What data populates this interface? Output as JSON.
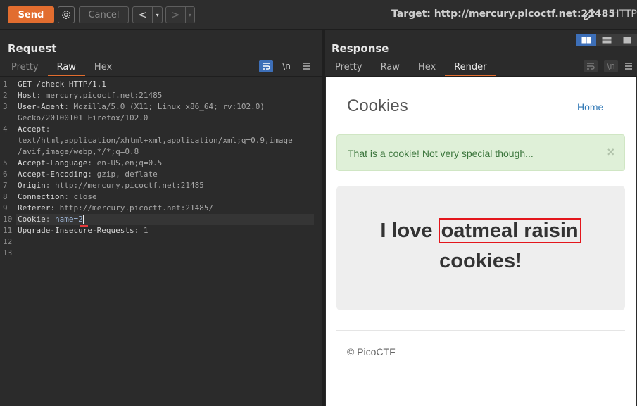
{
  "toolbar": {
    "send_label": "Send",
    "cancel_label": "Cancel",
    "back_glyph": "<",
    "forward_glyph": ">",
    "dropdown_glyph": "▾",
    "target_text": "Target: http://mercury.picoctf.net:21485",
    "http_label": "HTTP/"
  },
  "request": {
    "title": "Request",
    "tabs": [
      "Pretty",
      "Raw",
      "Hex"
    ],
    "active_tab": "Raw",
    "lines": [
      {
        "num": "1",
        "key": "GET /check HTTP/1.1",
        "sep": "",
        "val": ""
      },
      {
        "num": "2",
        "key": "Host",
        "sep": ": ",
        "val": "mercury.picoctf.net:21485"
      },
      {
        "num": "3",
        "key": "User-Agent",
        "sep": ": ",
        "val": "Mozilla/5.0 (X11; Linux x86_64; rv:102.0)"
      },
      {
        "num": "",
        "key": "",
        "sep": "",
        "val": "Gecko/20100101 Firefox/102.0"
      },
      {
        "num": "4",
        "key": "Accept",
        "sep": ":",
        "val": ""
      },
      {
        "num": "",
        "key": "",
        "sep": "",
        "val": "text/html,application/xhtml+xml,application/xml;q=0.9,image"
      },
      {
        "num": "",
        "key": "",
        "sep": "",
        "val": "/avif,image/webp,*/*;q=0.8"
      },
      {
        "num": "5",
        "key": "Accept-Language",
        "sep": ": ",
        "val": "en-US,en;q=0.5"
      },
      {
        "num": "6",
        "key": "Accept-Encoding",
        "sep": ": ",
        "val": "gzip, deflate"
      },
      {
        "num": "7",
        "key": "Origin",
        "sep": ": ",
        "val": "http://mercury.picoctf.net:21485"
      },
      {
        "num": "8",
        "key": "Connection",
        "sep": ": ",
        "val": "close"
      },
      {
        "num": "9",
        "key": "Referer",
        "sep": ": ",
        "val": "http://mercury.picoctf.net:21485/"
      },
      {
        "num": "10",
        "key": "Cookie",
        "sep": ": ",
        "val": "name=2"
      },
      {
        "num": "11",
        "key": "Upgrade-Insecure-Requests",
        "sep": ": ",
        "val": "1"
      },
      {
        "num": "12",
        "key": "",
        "sep": "",
        "val": ""
      },
      {
        "num": "13",
        "key": "",
        "sep": "",
        "val": ""
      }
    ],
    "tool_icons": [
      "wrap-icon",
      "newline-icon",
      "menu-icon"
    ],
    "newline_glyph": "\\n"
  },
  "response": {
    "title": "Response",
    "tabs": [
      "Pretty",
      "Raw",
      "Hex",
      "Render"
    ],
    "active_tab": "Render",
    "rendered": {
      "heading": "Cookies",
      "nav_home": "Home",
      "alert_text": "That is a cookie! Not very special though...",
      "alert_close": "×",
      "message_prefix": "I love ",
      "cookie_name": "oatmeal raisin",
      "message_suffix": "cookies!",
      "footer": "© PicoCTF"
    }
  },
  "colors": {
    "accent": "#e26d2f",
    "tool_active": "#3d6fb8",
    "alert_bg": "#dff0d8",
    "alert_text": "#3c763d",
    "highlight_box": "#e3161c"
  }
}
